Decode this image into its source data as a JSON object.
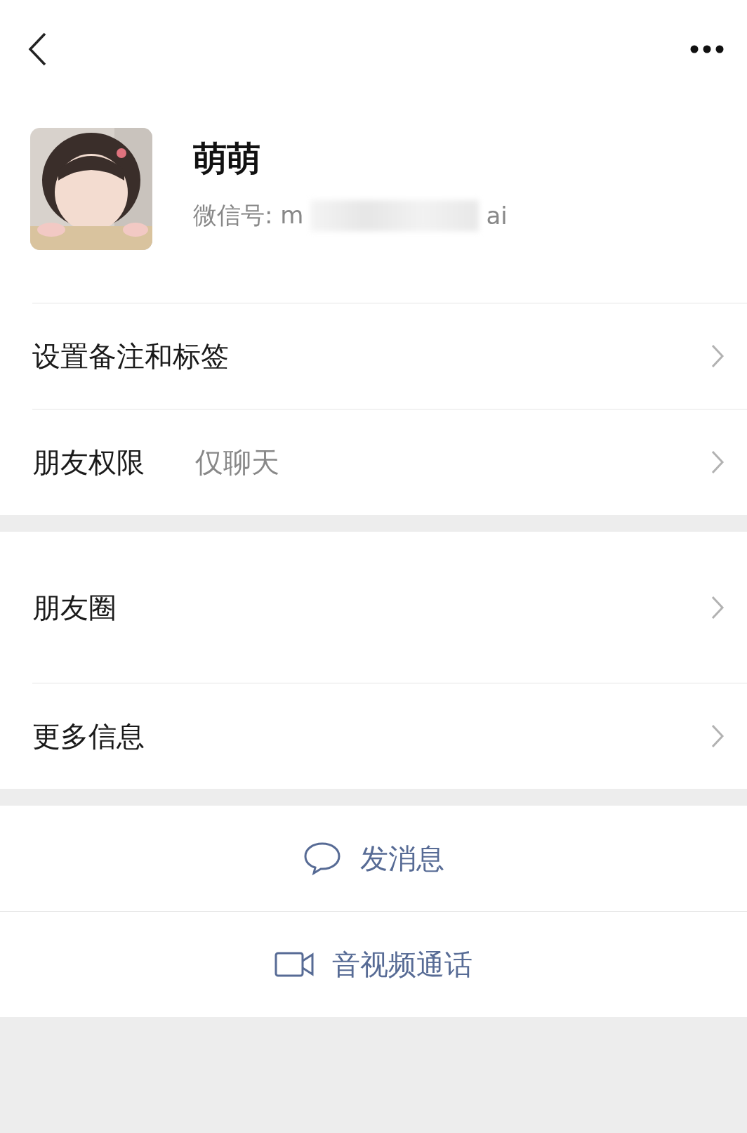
{
  "profile": {
    "name": "萌萌",
    "id_label": "微信号:",
    "id_start": "m",
    "id_end": "ai"
  },
  "sections": [
    {
      "rows": [
        {
          "label": "设置备注和标签",
          "kind": "plain"
        },
        {
          "label": "朋友权限",
          "value": "仅聊天",
          "kind": "plain"
        }
      ]
    },
    {
      "rows": [
        {
          "label": "朋友圈",
          "kind": "tall"
        },
        {
          "label": "更多信息",
          "kind": "plain"
        }
      ]
    }
  ],
  "actions": [
    {
      "label": "发消息",
      "kind": "message"
    },
    {
      "label": "音视频通话",
      "kind": "video"
    }
  ]
}
